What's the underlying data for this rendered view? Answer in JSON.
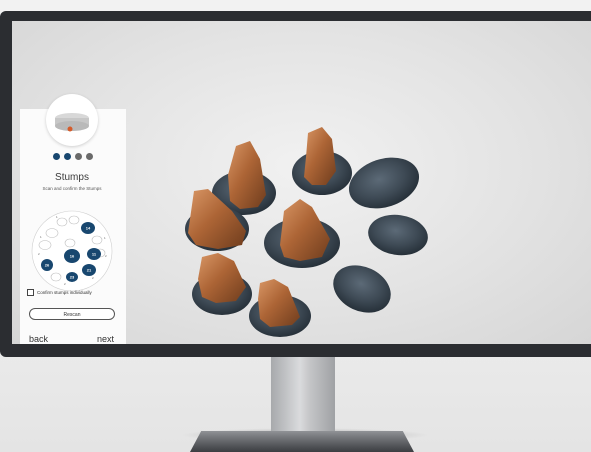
{
  "wizard": {
    "step_total": 4,
    "step_current": 1,
    "title": "Stumps",
    "subtitle": "Scan and confirm the Stumps",
    "teeth_selected": [
      "14",
      "16",
      "11",
      "21",
      "26",
      "23"
    ],
    "teeth_unselected": [
      "1",
      "1",
      "1",
      "1",
      "2",
      "2",
      "2",
      "2"
    ],
    "confirm_label": "Confirm stumps individually",
    "confirm_checked": false,
    "rescan_label": "Rescan",
    "back_label": "back",
    "next_label": "next"
  },
  "colors": {
    "accent": "#18476f",
    "stump": "#b06a3c",
    "scan_base": "#3d4a56",
    "monitor_bezel": "#2b2d31"
  }
}
